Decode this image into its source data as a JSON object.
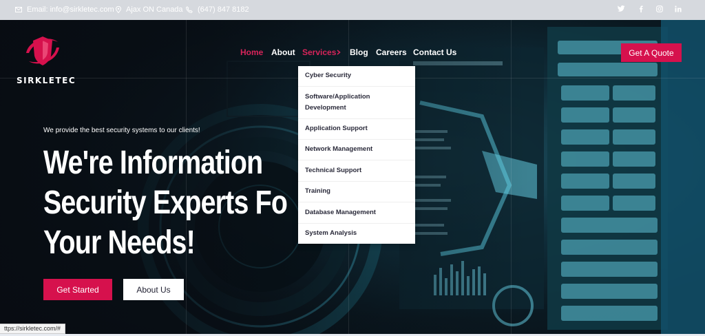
{
  "topbar": {
    "email": "Email: info@sirkletec.com",
    "location": "Ajax ON Canada",
    "phone": "(647) 847 8182",
    "social_icons": [
      "twitter-icon",
      "facebook-icon",
      "instagram-icon",
      "linkedin-icon"
    ]
  },
  "brand": {
    "name": "SIRKLETEC",
    "accent_color": "#d6114d"
  },
  "nav": {
    "items": [
      {
        "label": "Home"
      },
      {
        "label": "About"
      },
      {
        "label": "Services"
      },
      {
        "label": "Blog"
      },
      {
        "label": "Careers"
      },
      {
        "label": "Contact Us"
      }
    ],
    "cta": "Get A Quote"
  },
  "services_menu": {
    "items": [
      {
        "label": "Cyber Security"
      },
      {
        "label": "Software/Application Development"
      },
      {
        "label": "Application Support"
      },
      {
        "label": "Network Management"
      },
      {
        "label": "Technical Support"
      },
      {
        "label": "Training"
      },
      {
        "label": "Database Management"
      },
      {
        "label": "System Analysis"
      }
    ]
  },
  "hero": {
    "tagline": "We provide the best security systems to our clients!",
    "headline_line1": "We're Information",
    "headline_line2": "Security Experts Fo",
    "headline_line3": "Your Needs!",
    "primary_button": "Get Started",
    "secondary_button": "About Us"
  },
  "status_bar": {
    "url": "ttps://sirkletec.com/#"
  }
}
